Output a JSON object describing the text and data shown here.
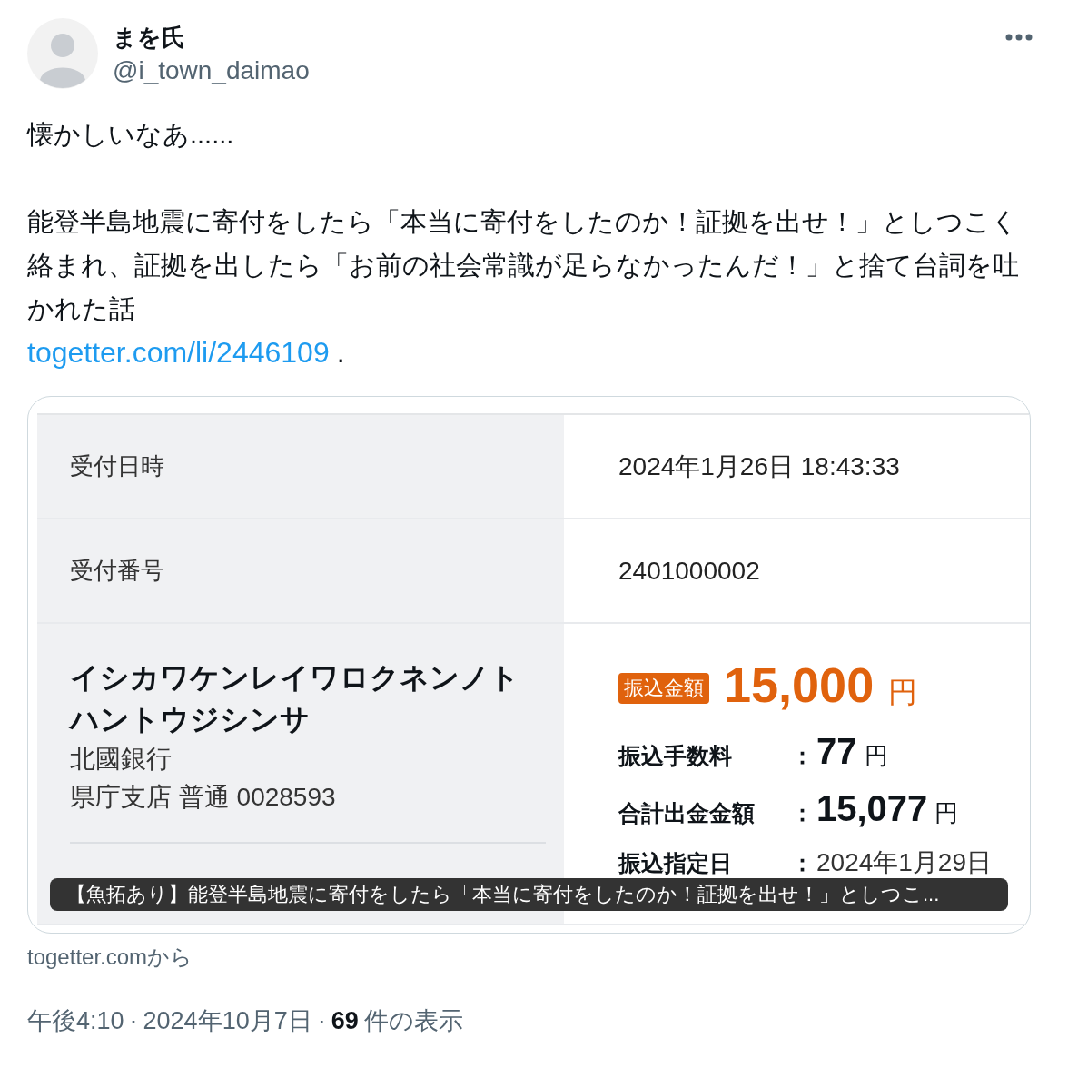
{
  "author": {
    "name": "まを氏",
    "handle": "@i_town_daimao"
  },
  "tweet": {
    "intro": "懐かしいなあ......",
    "body": "能登半島地震に寄付をしたら「本当に寄付をしたのか！証拠を出せ！」としつこく絡まれ、証拠を出したら「お前の社会常識が足らなかったんだ！」と捨て台詞を吐かれた話",
    "link": "togetter.com/li/2446109",
    "link_suffix": "."
  },
  "card": {
    "rows": [
      {
        "kind": "plain",
        "label": "受付日時",
        "value": "2024年1月26日 18:43:33"
      },
      {
        "kind": "plain",
        "label": "受付番号",
        "value": "2401000002"
      },
      {
        "kind": "transfer",
        "payee_lines": [
          "イシカワケンレイワロクネンノト",
          "ハントウジシンサ"
        ],
        "bank": "北國銀行",
        "account": "県庁支店 普通 0028593",
        "badge": "振込金額",
        "amount": "15,000",
        "unit": "円",
        "details": [
          {
            "kind": "money",
            "label": "振込手数料",
            "colon": "：",
            "value": "77",
            "unit": "円"
          },
          {
            "kind": "money",
            "label": "合計出金金額",
            "colon": "：",
            "value": "15,077",
            "unit": "円"
          },
          {
            "kind": "date",
            "label": "振込指定日",
            "colon": "：",
            "value": "2024年1月29日"
          }
        ]
      }
    ],
    "caption": "【魚拓あり】能登半島地震に寄付をしたら「本当に寄付をしたのか！証拠を出せ！」としつこ..."
  },
  "source": "togetter.comから",
  "meta": {
    "time": "午後4:10",
    "separator": "·",
    "date": "2024年10月7日",
    "views": "69",
    "views_label": "件の表示"
  }
}
